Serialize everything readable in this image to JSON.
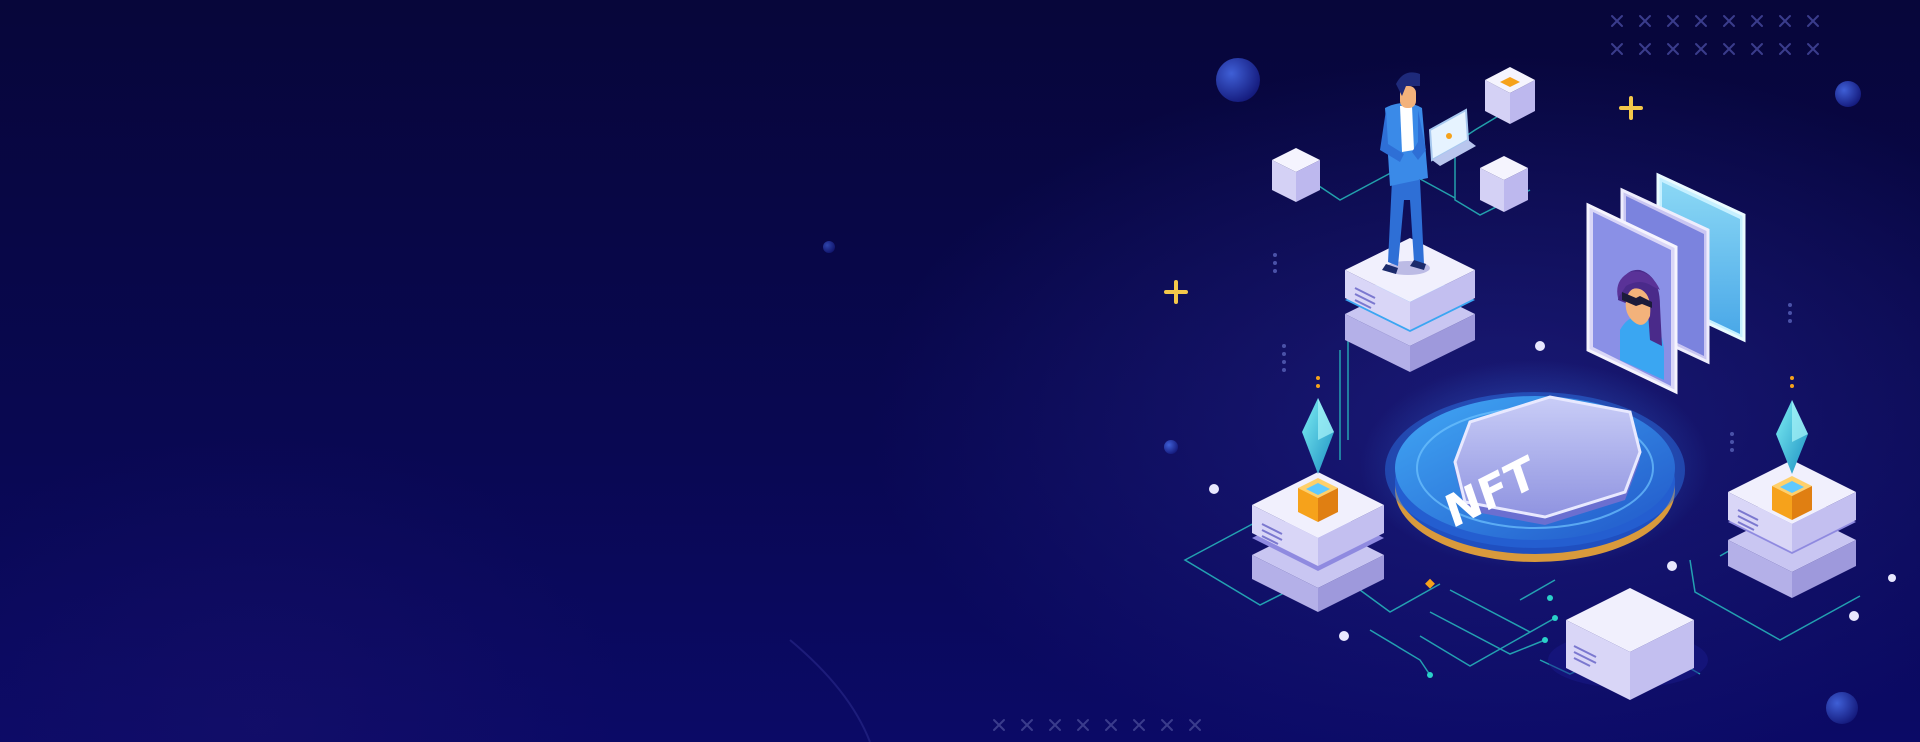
{
  "banner": {
    "platform_badge_text": "NFT"
  },
  "colors": {
    "background_top": "#07063a",
    "background_bottom": "#0b0a66",
    "circuit_line": "#2ad1c9",
    "platform_blue": "#2f7fe0",
    "block_white": "#e9e7fb",
    "block_lilac": "#c9c6f2",
    "crystal_teal": "#37c6dd",
    "cube_orange": "#f6a21b",
    "sparkle_yellow": "#f4c84a"
  },
  "icons": [
    "person-laptop-icon",
    "ethereum-crystal-icon",
    "avatar-card-icon",
    "plus-sparkle-icon",
    "cube-node-icon"
  ]
}
